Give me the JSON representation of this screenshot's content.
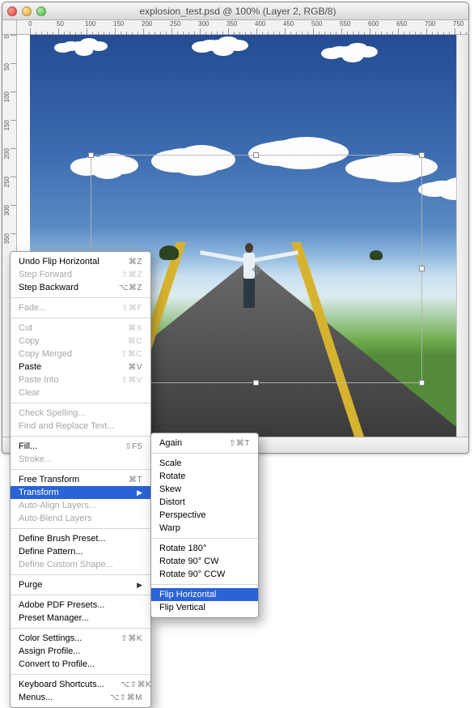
{
  "window": {
    "title": "explosion_test.psd @ 100% (Layer 2, RGB/8)"
  },
  "ruler": {
    "ticksH": [
      "0",
      "50",
      "100",
      "150",
      "200",
      "250",
      "300",
      "350",
      "400",
      "450",
      "500",
      "550",
      "600",
      "650",
      "700",
      "750"
    ],
    "ticksV": [
      "0",
      "50",
      "100",
      "150",
      "200",
      "250",
      "300",
      "350"
    ]
  },
  "edit_menu": {
    "items": [
      {
        "label": "Undo Flip Horizontal",
        "shortcut": "⌘Z",
        "enabled": true
      },
      {
        "label": "Step Forward",
        "shortcut": "⇧⌘Z",
        "enabled": false
      },
      {
        "label": "Step Backward",
        "shortcut": "⌥⌘Z",
        "enabled": true
      },
      {
        "sep": true
      },
      {
        "label": "Fade...",
        "shortcut": "⇧⌘F",
        "enabled": false
      },
      {
        "sep": true
      },
      {
        "label": "Cut",
        "shortcut": "⌘X",
        "enabled": false
      },
      {
        "label": "Copy",
        "shortcut": "⌘C",
        "enabled": false
      },
      {
        "label": "Copy Merged",
        "shortcut": "⇧⌘C",
        "enabled": false
      },
      {
        "label": "Paste",
        "shortcut": "⌘V",
        "enabled": true
      },
      {
        "label": "Paste Into",
        "shortcut": "⇧⌘V",
        "enabled": false
      },
      {
        "label": "Clear",
        "enabled": false
      },
      {
        "sep": true
      },
      {
        "label": "Check Spelling...",
        "enabled": false
      },
      {
        "label": "Find and Replace Text...",
        "enabled": false
      },
      {
        "sep": true
      },
      {
        "label": "Fill...",
        "shortcut": "⇧F5",
        "enabled": true
      },
      {
        "label": "Stroke...",
        "enabled": false
      },
      {
        "sep": true
      },
      {
        "label": "Free Transform",
        "shortcut": "⌘T",
        "enabled": true
      },
      {
        "label": "Transform",
        "submenu": true,
        "enabled": true,
        "highlight": true
      },
      {
        "label": "Auto-Align Layers...",
        "enabled": false
      },
      {
        "label": "Auto-Blend Layers",
        "enabled": false
      },
      {
        "sep": true
      },
      {
        "label": "Define Brush Preset...",
        "enabled": true
      },
      {
        "label": "Define Pattern...",
        "enabled": true
      },
      {
        "label": "Define Custom Shape...",
        "enabled": false
      },
      {
        "sep": true
      },
      {
        "label": "Purge",
        "submenu": true,
        "enabled": true
      },
      {
        "sep": true
      },
      {
        "label": "Adobe PDF Presets...",
        "enabled": true
      },
      {
        "label": "Preset Manager...",
        "enabled": true
      },
      {
        "sep": true
      },
      {
        "label": "Color Settings...",
        "shortcut": "⇧⌘K",
        "enabled": true
      },
      {
        "label": "Assign Profile...",
        "enabled": true
      },
      {
        "label": "Convert to Profile...",
        "enabled": true
      },
      {
        "sep": true
      },
      {
        "label": "Keyboard Shortcuts...",
        "shortcut": "⌥⇧⌘K",
        "enabled": true
      },
      {
        "label": "Menus...",
        "shortcut": "⌥⇧⌘M",
        "enabled": true
      }
    ]
  },
  "transform_submenu": {
    "items": [
      {
        "label": "Again",
        "shortcut": "⇧⌘T",
        "enabled": true
      },
      {
        "sep": true
      },
      {
        "label": "Scale",
        "enabled": true
      },
      {
        "label": "Rotate",
        "enabled": true
      },
      {
        "label": "Skew",
        "enabled": true
      },
      {
        "label": "Distort",
        "enabled": true
      },
      {
        "label": "Perspective",
        "enabled": true
      },
      {
        "label": "Warp",
        "enabled": true
      },
      {
        "sep": true
      },
      {
        "label": "Rotate 180°",
        "enabled": true
      },
      {
        "label": "Rotate 90° CW",
        "enabled": true
      },
      {
        "label": "Rotate 90° CCW",
        "enabled": true
      },
      {
        "sep": true
      },
      {
        "label": "Flip Horizontal",
        "enabled": true,
        "highlight": true
      },
      {
        "label": "Flip Vertical",
        "enabled": true
      }
    ]
  }
}
